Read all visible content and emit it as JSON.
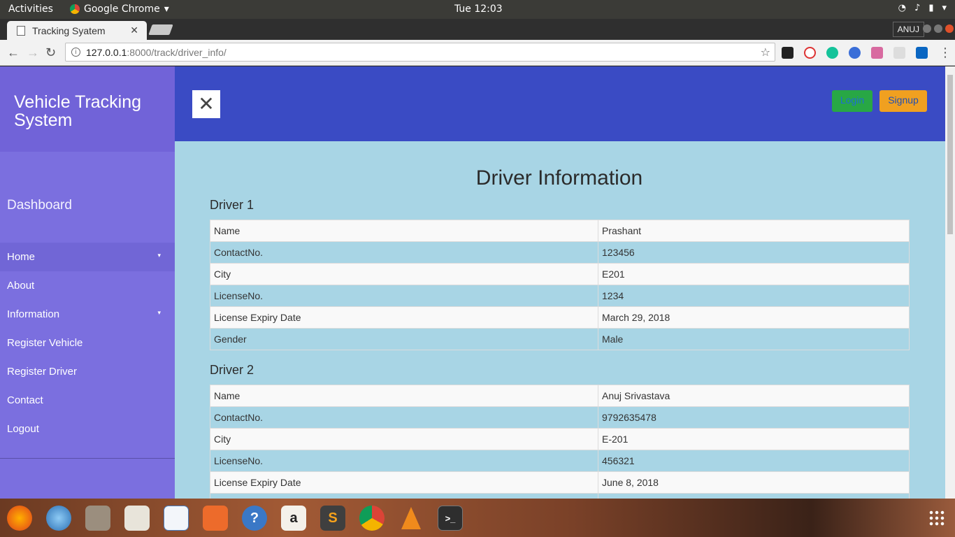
{
  "topbar": {
    "activities": "Activities",
    "app": "Google Chrome",
    "clock": "Tue 12:03"
  },
  "browser": {
    "tab_title": "Tracking Syatem",
    "profile": "ANUJ",
    "url_host": "127.0.0.1",
    "url_path": ":8000/track/driver_info/"
  },
  "sidebar": {
    "brand": "Vehicle Tracking System",
    "dashboard": "Dashboard",
    "items": [
      {
        "label": "Home",
        "caret": "▾"
      },
      {
        "label": "About"
      },
      {
        "label": "Information",
        "caret": "▾"
      },
      {
        "label": "Register Vehicle"
      },
      {
        "label": "Register Driver"
      },
      {
        "label": "Contact"
      },
      {
        "label": "Logout"
      }
    ]
  },
  "header": {
    "toggle": "✕",
    "login": "Login",
    "signup": "Signup"
  },
  "page": {
    "title": "Driver Information",
    "drivers": [
      {
        "title": "Driver 1",
        "rows": [
          {
            "k": "Name",
            "v": "Prashant"
          },
          {
            "k": "ContactNo.",
            "v": "123456"
          },
          {
            "k": "City",
            "v": "E201"
          },
          {
            "k": "LicenseNo.",
            "v": "1234"
          },
          {
            "k": "License Expiry Date",
            "v": "March 29, 2018"
          },
          {
            "k": "Gender",
            "v": "Male"
          }
        ]
      },
      {
        "title": "Driver 2",
        "rows": [
          {
            "k": "Name",
            "v": "Anuj Srivastava"
          },
          {
            "k": "ContactNo.",
            "v": "9792635478"
          },
          {
            "k": "City",
            "v": "E-201"
          },
          {
            "k": "LicenseNo.",
            "v": "456321"
          },
          {
            "k": "License Expiry Date",
            "v": "June 8, 2018"
          }
        ]
      }
    ]
  },
  "dock": {
    "amazon": "a",
    "sublime": "S"
  }
}
